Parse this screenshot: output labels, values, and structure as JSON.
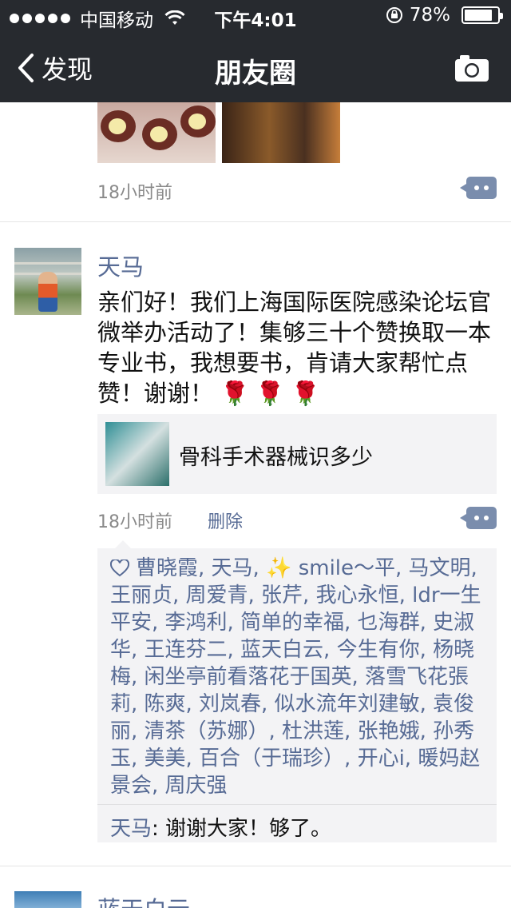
{
  "status_bar": {
    "carrier": "中国移动",
    "time": "下午4:01",
    "battery": "78%",
    "battery_level": 0.78
  },
  "nav": {
    "back_label": "发现",
    "title": "朋友圈"
  },
  "prev_post": {
    "time": "18小时前"
  },
  "post": {
    "author": "天马",
    "text": "亲们好！我们上海国际医院感染论坛官微举办活动了！集够三十个赞换取一本专业书，我想要书，肯请大家帮忙点赞！谢谢！",
    "flowers": "🌹🌹🌹",
    "link_title": "骨科手术器械识多少",
    "time": "18小时前",
    "delete_label": "删除",
    "likes": "曹晓霞, 天马, ✨ smile～平, 马文明, 王丽贞, 周爱青, 张芹, 我心永恒, ldr一生平安, 李鸿利, 简单的幸福, 乜海群, 史淑华, 王连芬二, 蓝天白云, 今生有你, 杨晓梅, 闲坐亭前看落花于国英, 落雪飞花張莉, 陈爽, 刘岚春, 似水流年刘建敏, 袁俊丽, 清茶（苏娜）, 杜洪莲, 张艳娥, 孙秀玉, 美美, 百合（于瑞珍）, 开心i, 暖妈赵景会, 周庆强",
    "reply_author": "天马",
    "reply_text": ": 谢谢大家！够了。"
  },
  "next_post": {
    "author": "蓝天白云"
  },
  "colors": {
    "header_bg": "#272a2f",
    "link_blue": "#576b95",
    "comment_btn": "#7a8dad"
  }
}
